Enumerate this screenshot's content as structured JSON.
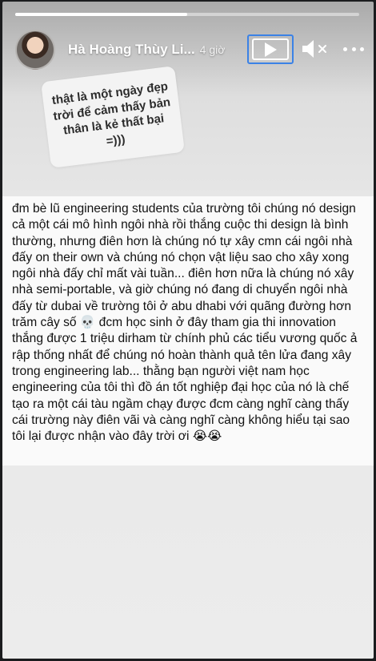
{
  "story": {
    "progress_fraction": 0.5,
    "username": "Hà Hoàng Thùy Li...",
    "timestamp": "4 giờ",
    "sticker_text": "thật là một ngày đẹp trời để cảm thấy bản thân là kẻ thất bại =)))",
    "post_text": "đm bè lũ engineering students của trường tôi chúng nó design cả một cái mô hình ngôi nhà rồi thắng cuộc thi design là bình thường, nhưng điên hơn là chúng nó tự xây cmn cái ngôi nhà đấy on their own và chúng nó chọn vật liệu sao cho xây xong ngôi nhà đấy chỉ mất vài tuần... điên hơn nữa là chúng nó xây nhà semi-portable, và giờ chúng nó đang di chuyển ngôi nhà đấy từ dubai về trường tôi ở abu dhabi với quãng đường hơn trăm cây số 💀 đcm học sinh ở đây tham gia thi innovation thắng được 1 triệu dirham từ chính phủ các tiểu vương quốc ả rập thống nhất để chúng nó hoàn thành quả tên lửa đang xây trong engineering lab... thằng bạn người việt nam học engineering của tôi thì đồ án tốt nghiệp đại học của nó là chế tạo ra một cái tàu ngầm chạy được đcm càng nghĩ càng thấy cái trường này điên vãi và càng nghĩ càng không hiểu tại sao tôi lại được nhận vào đây trời ơi 😭😭"
  },
  "controls": {
    "play": "play-icon",
    "mute": "speaker-muted-icon",
    "more": "more-horizontal-icon"
  },
  "colors": {
    "focus_ring": "#3b82e6",
    "background": "#1b1c1e"
  }
}
